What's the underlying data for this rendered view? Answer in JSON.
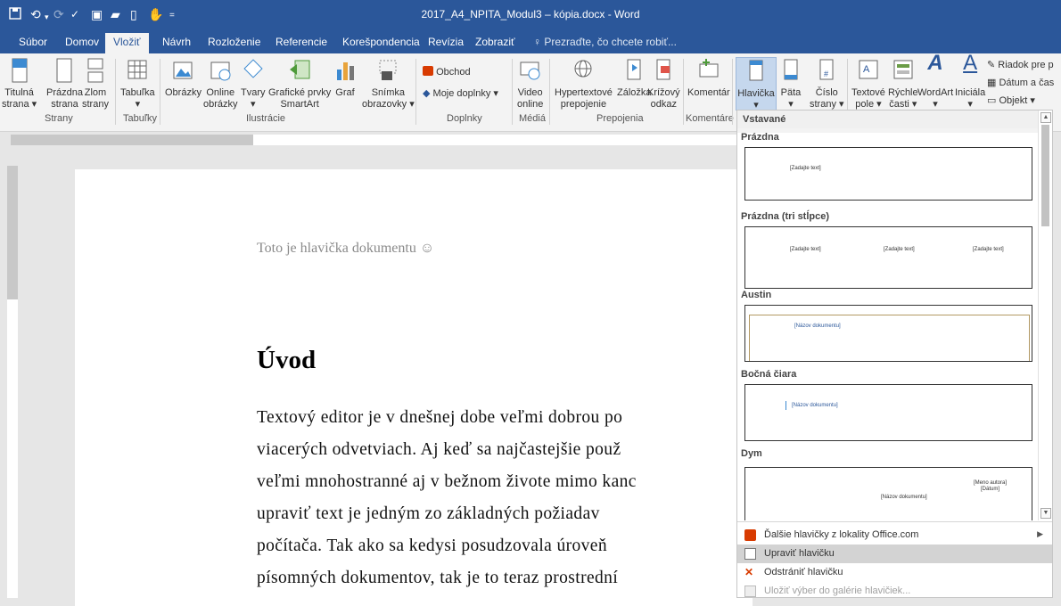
{
  "titlebar": {
    "title": "2017_A4_NPITA_Modul3 – kópia.docx - Word"
  },
  "tabs": [
    "Súbor",
    "Domov",
    "Vložiť",
    "Návrh",
    "Rozloženie",
    "Referencie",
    "Korešpondencia",
    "Revízia",
    "Zobraziť"
  ],
  "tell_me": "Prezraďte, čo chcete robiť...",
  "ribbon": {
    "strany": {
      "label": "Strany",
      "titulna": [
        "Titulná",
        "strana ▾"
      ],
      "prazdna": [
        "Prázdna",
        "strana"
      ],
      "zlom": [
        "Zlom",
        "strany"
      ]
    },
    "tabulky": {
      "label": "Tabuľky",
      "tabulka": [
        "Tabuľka",
        "▾"
      ]
    },
    "ilustracie": {
      "label": "Ilustrácie",
      "obrazky": [
        "Obrázky",
        ""
      ],
      "online": [
        "Online",
        "obrázky"
      ],
      "tvary": [
        "Tvary",
        "▾"
      ],
      "smartart": [
        "Grafické prvky",
        "SmartArt"
      ],
      "graf": [
        "Graf",
        ""
      ],
      "snimka": [
        "Snímka",
        "obrazovky ▾"
      ]
    },
    "doplnky": {
      "label": "Doplnky",
      "obchod": "Obchod",
      "moje": "Moje doplnky"
    },
    "media": {
      "label": "Médiá",
      "video": [
        "Video",
        "online"
      ]
    },
    "prepojenia": {
      "label": "Prepojenia",
      "hyper": [
        "Hypertextové",
        "prepojenie"
      ],
      "zalozka": [
        "Záložka",
        ""
      ],
      "krizovy": [
        "Krížový",
        "odkaz"
      ]
    },
    "komentare": {
      "label": "Komentáre",
      "komentar": [
        "Komentár",
        ""
      ]
    },
    "hlavicka": {
      "hlavicka": [
        "Hlavička",
        "▾"
      ],
      "pata": [
        "Päta",
        "▾"
      ],
      "cislo": [
        "Číslo",
        "strany ▾"
      ]
    },
    "text": {
      "textove": [
        "Textové",
        "pole ▾"
      ],
      "rychle": [
        "Rýchle",
        "časti ▾"
      ],
      "wordart": [
        "WordArt",
        "▾"
      ],
      "inicial": [
        "Iniciála",
        "▾"
      ],
      "riadok": "Riadok pre p",
      "datum": "Dátum a čas",
      "objekt": "Objekt"
    }
  },
  "document": {
    "header_text": "Toto je hlavička dokumentu ☺",
    "heading": "Úvod",
    "lines": [
      "Textový editor je v dnešnej dobe veľmi dobrou po",
      "viacerých odvetviach. Aj keď sa najčastejšie použ",
      "veľmi mnohostranné aj v bežnom živote mimo kanc",
      "upraviť text je jedným zo základných požiadav",
      "počítača. Tak ako sa kedysi posudzovala úroveň",
      "písomných dokumentov, tak je to teraz prostrední"
    ]
  },
  "gallery": {
    "section": "Vstavané",
    "items": [
      {
        "name": "Prázdna",
        "placeholders": [
          "[Zadajte text]"
        ]
      },
      {
        "name": "Prázdna (tri stĺpce)",
        "placeholders": [
          "[Zadajte text]",
          "[Zadajte text]",
          "[Zadajte text]"
        ]
      },
      {
        "name": "Austin",
        "placeholders": [
          "[Názov dokumentu]"
        ]
      },
      {
        "name": "Bočná čiara",
        "placeholders": [
          "[Názov dokumentu]"
        ]
      },
      {
        "name": "Dym",
        "placeholders": [
          "[Meno autora]",
          "[Dátum]",
          "[Názov dokumentu]"
        ]
      }
    ],
    "menu": [
      {
        "label": "Ďalšie hlavičky z lokality Office.com",
        "icon": "office-icon",
        "enabled": true
      },
      {
        "label": "Upraviť hlavičku",
        "icon": "edit-header-icon",
        "enabled": true
      },
      {
        "label": "Odstrániť hlavičku",
        "icon": "remove-header-icon",
        "enabled": true
      },
      {
        "label": "Uložiť výber do galérie hlavičiek...",
        "icon": "save-gallery-icon",
        "enabled": false
      }
    ]
  },
  "colors": {
    "accent": "#2b579a",
    "highlight": "#c5d7ed"
  }
}
